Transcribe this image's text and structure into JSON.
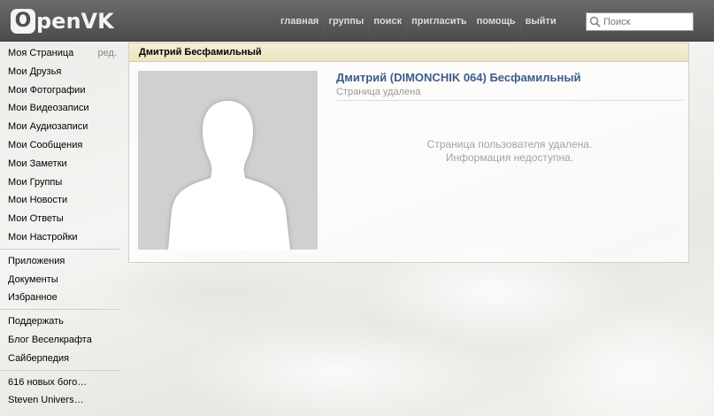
{
  "header": {
    "logo_letter": "O",
    "logo_rest": "penVK",
    "nav": [
      "главная",
      "группы",
      "поиск",
      "пригласить",
      "помощь",
      "выйти"
    ],
    "search_placeholder": "Поиск"
  },
  "sidebar": {
    "main": [
      {
        "label": "Моя Страница",
        "extra": "ред."
      },
      {
        "label": "Мои Друзья"
      },
      {
        "label": "Мои Фотографии"
      },
      {
        "label": "Мои Видеозаписи"
      },
      {
        "label": "Мои Аудиозаписи"
      },
      {
        "label": "Мои Сообщения"
      },
      {
        "label": "Мои Заметки"
      },
      {
        "label": "Мои Группы"
      },
      {
        "label": "Мои Новости"
      },
      {
        "label": "Мои Ответы"
      },
      {
        "label": "Мои Настройки"
      }
    ],
    "apps": [
      "Приложения",
      "Документы",
      "Избранное"
    ],
    "links": [
      "Поддержать",
      "Блог Веселкрафта",
      "Сайберпедия"
    ],
    "groups": [
      "616 новых бого…",
      "Steven Univers…"
    ]
  },
  "content": {
    "header_title": "Дмитрий Бесфамильный",
    "profile_name": "Дмитрий (DIMONCHIK 064) Бесфамильный",
    "status": "Страница удалена",
    "message_line1": "Страница пользователя удалена.",
    "message_line2": "Информация недоступна."
  },
  "colors": {
    "header_bg": "#555555",
    "name_link": "#3d5c8a",
    "content_header_bg": "#f0e9cb"
  }
}
